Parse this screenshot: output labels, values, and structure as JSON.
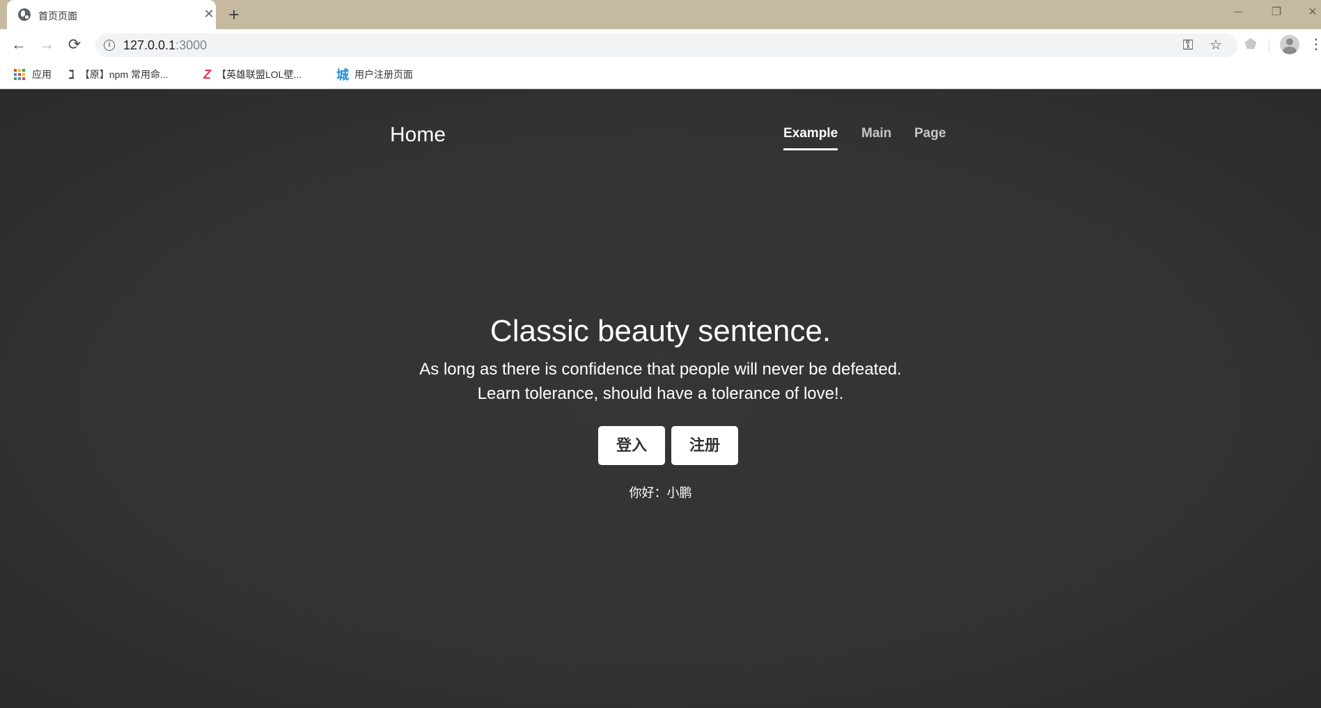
{
  "browser": {
    "tab_title": "首页页面",
    "tab_close": "✕",
    "new_tab": "+",
    "window_controls": {
      "minimize": "─",
      "restore": "❐",
      "close": "✕"
    },
    "nav": {
      "back": "←",
      "forward": "→",
      "reload": "⟳"
    },
    "url_host": "127.0.0.1",
    "url_port": ":3000",
    "icons": {
      "key": "key-icon",
      "star": "star-icon",
      "extension": "tag-icon",
      "menu": "more-vert-icon"
    },
    "bookmarks": [
      {
        "label": "应用",
        "icon": "apps-grid-icon"
      },
      {
        "label": "【原】npm 常用命...",
        "icon": "bookmark-a-icon",
        "glyph": "ℷ"
      },
      {
        "label": "【英雄联盟LOL壁...",
        "icon": "bookmark-z-icon",
        "glyph": "Z"
      },
      {
        "label": "用户注册页面",
        "icon": "bookmark-cheng-icon",
        "glyph": "城"
      }
    ]
  },
  "page": {
    "brand": "Home",
    "nav": [
      {
        "label": "Example",
        "active": true
      },
      {
        "label": "Main",
        "active": false
      },
      {
        "label": "Page",
        "active": false
      }
    ],
    "hero": {
      "title": "Classic beauty sentence.",
      "lead_line1": "As long as there is confidence that people will never be defeated.",
      "lead_line2": "Learn tolerance, should have a tolerance of love!."
    },
    "buttons": {
      "login": "登入",
      "register": "注册"
    },
    "greeting": "你好：小鹏"
  },
  "colors": {
    "tabbar": "#c5baa0",
    "page_background": "#333333",
    "text": "#ffffff"
  }
}
